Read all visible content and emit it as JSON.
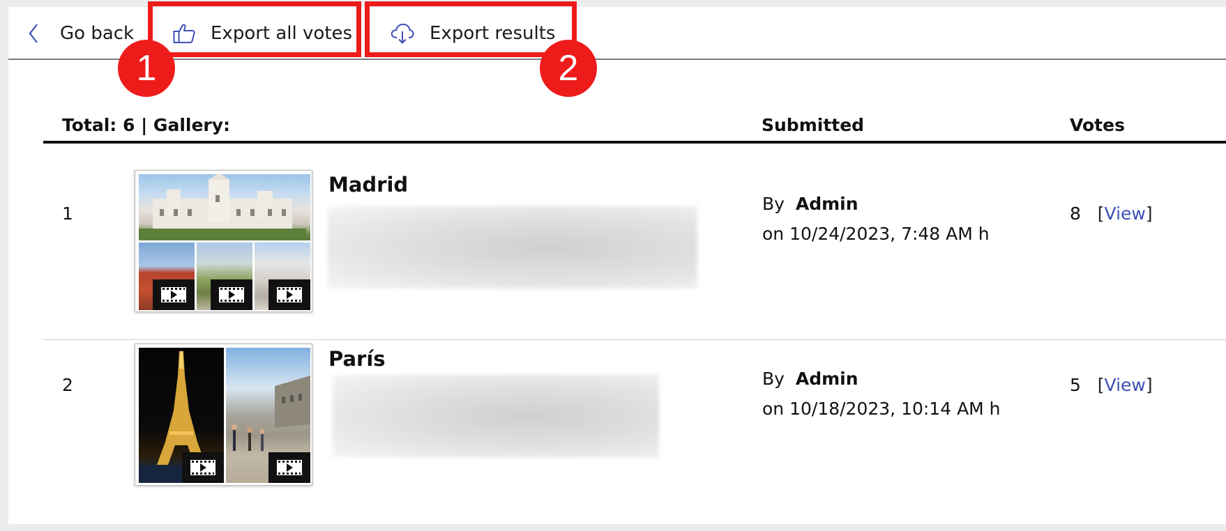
{
  "toolbar": {
    "back_label": "Go back",
    "export_votes_label": "Export all votes",
    "export_results_label": "Export results"
  },
  "annotations": {
    "badge1": "1",
    "badge2": "2",
    "highlight_color": "#ee1b1b"
  },
  "table": {
    "header_total": "Total: 6 | Gallery:",
    "header_submitted": "Submitted",
    "header_votes": "Votes"
  },
  "rows": [
    {
      "rank": "1",
      "title": "Madrid",
      "by_prefix": "By",
      "author": "Admin",
      "date": "on 10/24/2023, 7:48 AM h",
      "votes": "8",
      "view_label": "View"
    },
    {
      "rank": "2",
      "title": "París",
      "by_prefix": "By",
      "author": "Admin",
      "date": "on 10/18/2023, 10:14 AM h",
      "votes": "5",
      "view_label": "View"
    }
  ],
  "colors": {
    "link": "#3b4fb5",
    "icon": "#3b4fb5"
  }
}
